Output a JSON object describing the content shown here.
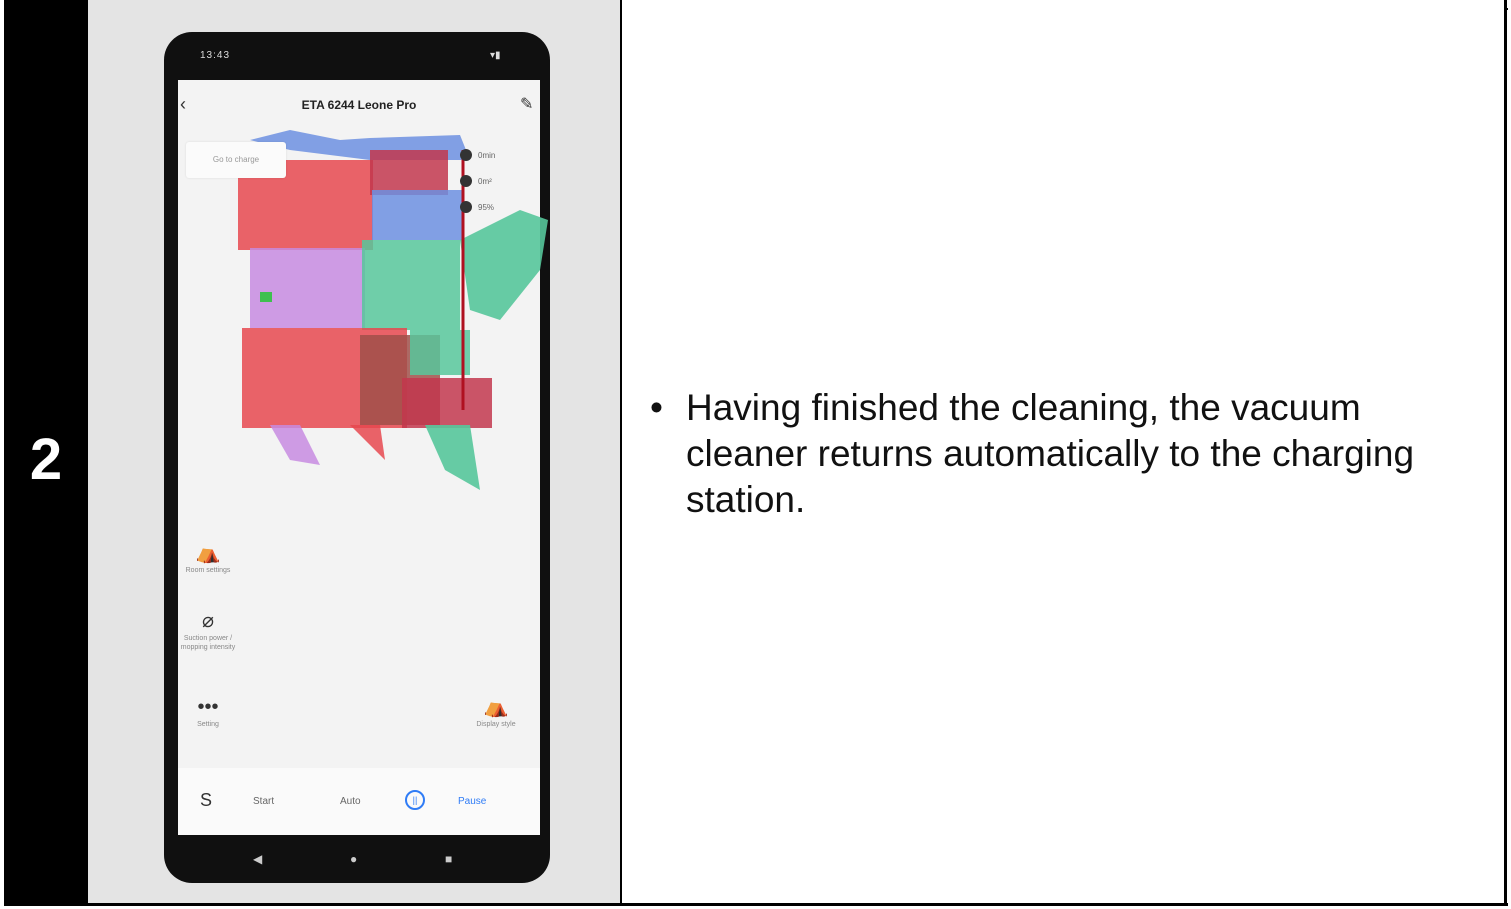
{
  "step": {
    "number": "2"
  },
  "instruction": {
    "bullet": "•",
    "text": "Having finished the cleaning, the vacuum cleaner returns automatically to the charging station."
  },
  "phone": {
    "status_time": "13:43",
    "app_title": "ETA 6244 Leone Pro",
    "goto_charge": "Go to charge",
    "stats": [
      "0min",
      "0m²",
      "95%"
    ],
    "side_buttons": {
      "room_settings": "Room settings",
      "suction": "Suction power / mopping intensity",
      "setting": "Setting",
      "display_style": "Display style"
    },
    "bottom_bar": {
      "start": "Start",
      "auto": "Auto",
      "pause": "Pause"
    },
    "colors": {
      "accent": "#2f7cf6",
      "room_red": "#e6484f",
      "room_green": "#57c79b",
      "room_purple": "#c78be0",
      "room_blue": "#6c8fe0"
    }
  }
}
